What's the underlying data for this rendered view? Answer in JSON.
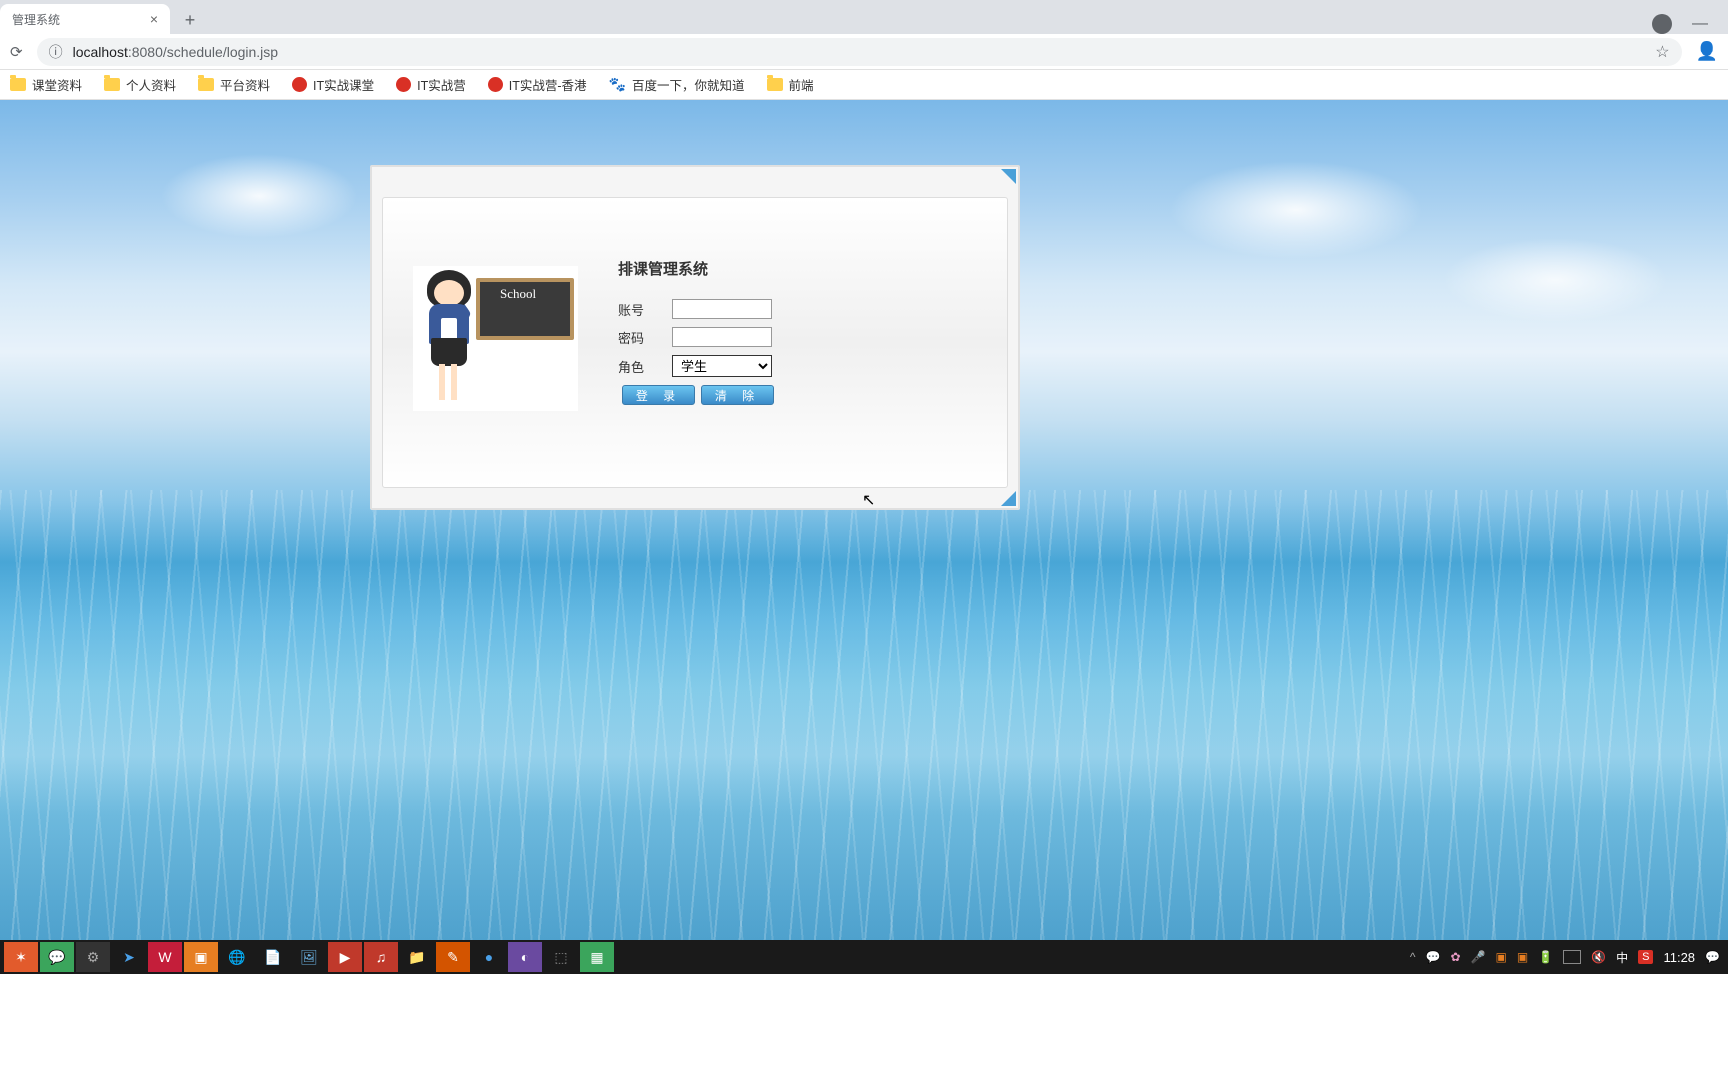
{
  "browser": {
    "tab_title": "管理系统",
    "url_host": "localhost",
    "url_port": ":8080",
    "url_path": "/schedule/login.jsp",
    "bookmarks": [
      {
        "type": "folder",
        "label": "课堂资料"
      },
      {
        "type": "folder",
        "label": "个人资料"
      },
      {
        "type": "folder",
        "label": "平台资料"
      },
      {
        "type": "red",
        "label": "IT实战课堂"
      },
      {
        "type": "red",
        "label": "IT实战营"
      },
      {
        "type": "red",
        "label": "IT实战营-香港"
      },
      {
        "type": "paw",
        "label": "百度一下，你就知道"
      },
      {
        "type": "folder",
        "label": "前端"
      }
    ]
  },
  "login": {
    "title": "排课管理系统",
    "board_text": "School",
    "labels": {
      "account": "账号",
      "password": "密码",
      "role": "角色"
    },
    "role_value": "学生",
    "buttons": {
      "login": "登 录",
      "clear": "清 除"
    }
  },
  "taskbar": {
    "ime": "中",
    "input_method": "S",
    "time": "11:28"
  }
}
